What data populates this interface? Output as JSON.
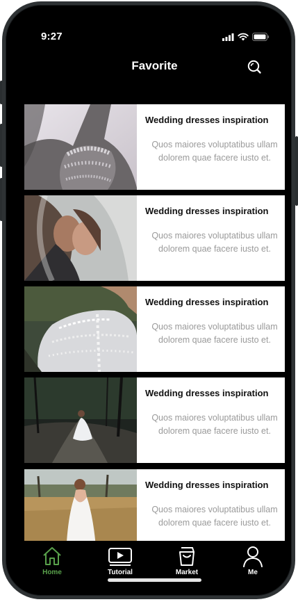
{
  "status_bar": {
    "time": "9:27",
    "icons": [
      "signal-icon",
      "wifi-icon",
      "battery-icon"
    ]
  },
  "header": {
    "title": "Favorite",
    "search_icon": "search-icon"
  },
  "cards": [
    {
      "title": "Wedding dresses inspiration",
      "description": "Quos maiores voluptatibus ullam dolorem quae facere iusto et."
    },
    {
      "title": "Wedding dresses inspiration",
      "description": "Quos maiores voluptatibus ullam dolorem quae facere iusto et."
    },
    {
      "title": "Wedding dresses inspiration",
      "description": "Quos maiores voluptatibus ullam dolorem quae facere iusto et."
    },
    {
      "title": "Wedding dresses inspiration",
      "description": "Quos maiores voluptatibus ullam dolorem quae facere iusto et."
    },
    {
      "title": "Wedding dresses inspiration",
      "description": "Quos maiores voluptatibus ullam dolorem quae facere iusto et."
    }
  ],
  "tab_bar": {
    "active": "Home",
    "active_color": "#59a14b",
    "items": [
      {
        "label": "Home",
        "icon": "home-icon"
      },
      {
        "label": "Tutorial",
        "icon": "video-play-icon"
      },
      {
        "label": "Market",
        "icon": "shopping-bag-icon"
      },
      {
        "label": "Me",
        "icon": "person-icon"
      }
    ]
  }
}
